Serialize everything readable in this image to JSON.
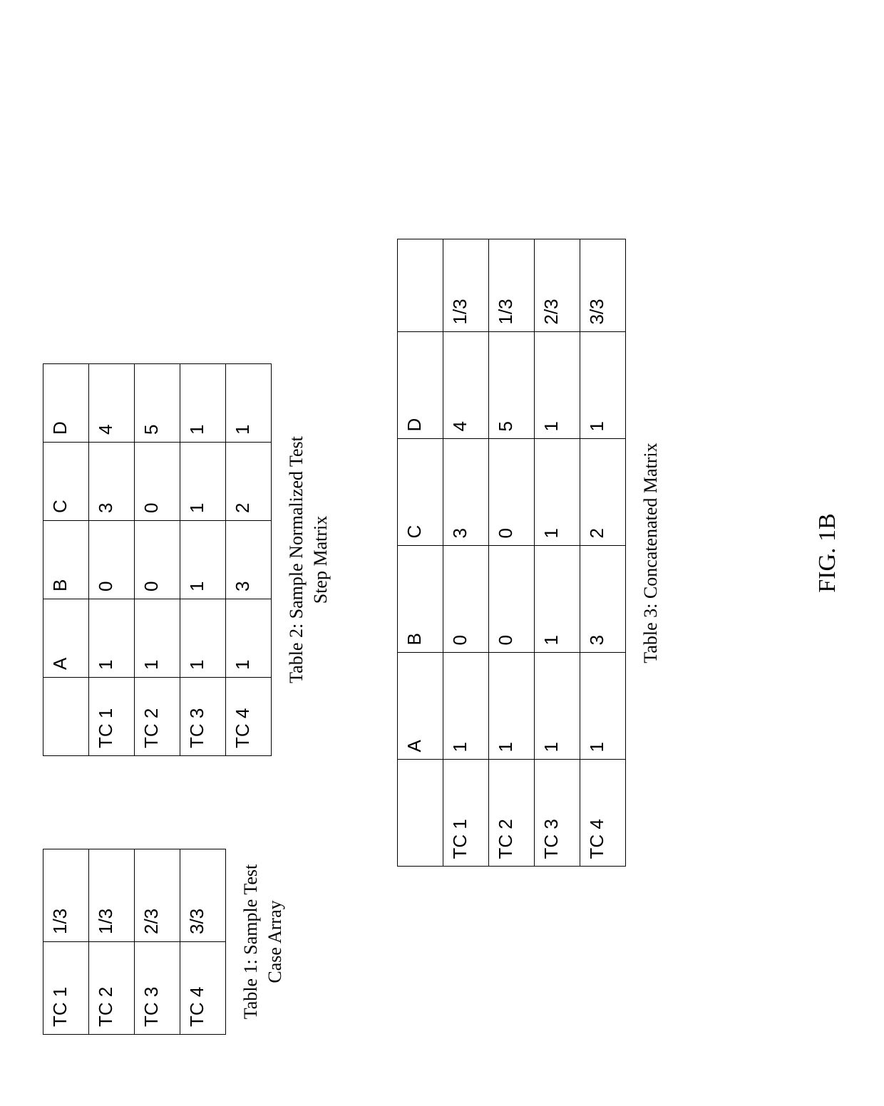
{
  "figure_label": "FIG. 1B",
  "table1": {
    "caption": "Table 1: Sample Test\nCase Array",
    "rows": [
      {
        "id": "TC 1",
        "value": "1/3"
      },
      {
        "id": "TC 2",
        "value": "1/3"
      },
      {
        "id": "TC 3",
        "value": "2/3"
      },
      {
        "id": "TC 4",
        "value": "3/3"
      }
    ]
  },
  "table2": {
    "caption": "Table 2: Sample Normalized Test\nStep Matrix",
    "cols": [
      "A",
      "B",
      "C",
      "D"
    ],
    "rows": [
      {
        "id": "TC 1",
        "cells": [
          "1",
          "0",
          "3",
          "4"
        ]
      },
      {
        "id": "TC 2",
        "cells": [
          "1",
          "0",
          "0",
          "5"
        ]
      },
      {
        "id": "TC 3",
        "cells": [
          "1",
          "1",
          "1",
          "1"
        ]
      },
      {
        "id": "TC 4",
        "cells": [
          "1",
          "3",
          "2",
          "1"
        ]
      }
    ]
  },
  "table3": {
    "caption": "Table 3: Concatenated Matrix",
    "cols": [
      "A",
      "B",
      "C",
      "D"
    ],
    "rows": [
      {
        "id": "TC 1",
        "cells": [
          "1",
          "0",
          "3",
          "4"
        ],
        "ratio": "1/3"
      },
      {
        "id": "TC 2",
        "cells": [
          "1",
          "0",
          "0",
          "5"
        ],
        "ratio": "1/3"
      },
      {
        "id": "TC 3",
        "cells": [
          "1",
          "1",
          "1",
          "1"
        ],
        "ratio": "2/3"
      },
      {
        "id": "TC 4",
        "cells": [
          "1",
          "3",
          "2",
          "1"
        ],
        "ratio": "3/3"
      }
    ]
  }
}
